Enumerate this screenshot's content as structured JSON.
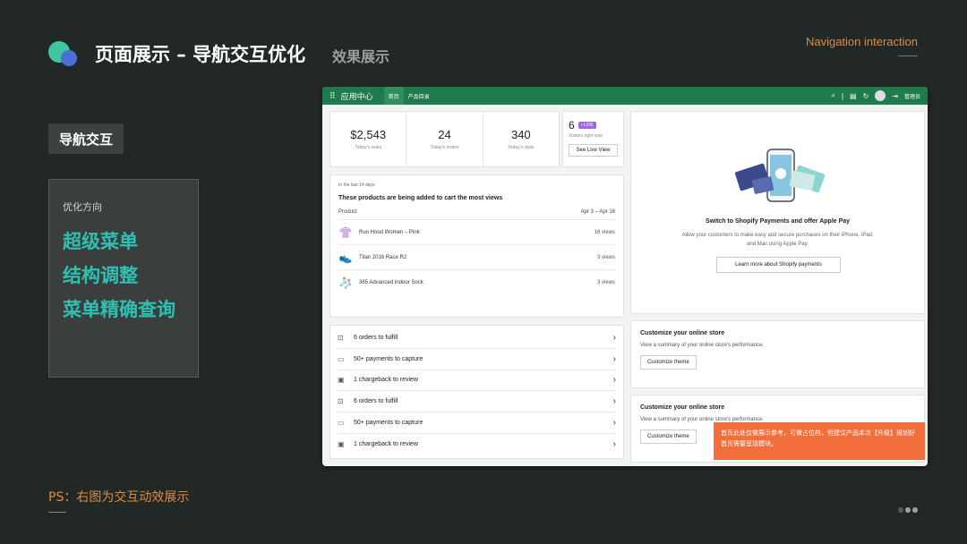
{
  "header": {
    "title": "页面展示 – 导航交互优化",
    "subtitle": "效果展示",
    "corner_label": "Navigation interaction"
  },
  "left": {
    "tag": "导航交互",
    "box_title": "优化方向",
    "items": [
      "超级菜单",
      "结构调整",
      "菜单精确查询"
    ]
  },
  "footer": {
    "ps": "PS：右图为交互动效展示"
  },
  "shot": {
    "app_name": "应用中心",
    "tabs": [
      "首页",
      "产品目录"
    ],
    "admin_label": "管理员",
    "stats": [
      {
        "value": "$2,543",
        "label": "Today's sales"
      },
      {
        "value": "24",
        "label": "Today's orders"
      },
      {
        "value": "340",
        "label": "Today's visits"
      }
    ],
    "live": {
      "value": "6",
      "badge": "• LIVE",
      "label": "Visitors right now",
      "button": "See Live View"
    },
    "products": {
      "range_label": "In the last 14 days",
      "heading": "These products are being added to cart the most views",
      "col_product": "Product",
      "col_date": "Apr 3 – Apr 16",
      "rows": [
        {
          "name": "Run Hood Women – Pink",
          "views": "16 views"
        },
        {
          "name": "Titan 2016 Race R2",
          "views": "3 views"
        },
        {
          "name": "365 Advanced Indoor Sock",
          "views": "3 views"
        }
      ]
    },
    "tasks": [
      "6 orders to fulfill",
      "50+ payments to capture",
      "1 chargeback to review",
      "6 orders to fulfill",
      "50+ payments to capture",
      "1 chargeback to review"
    ],
    "pay": {
      "heading": "Switch to Shopify Payments and offer Apple Pay",
      "desc": "Allow your customers to make easy and secure purchases on their iPhone, iPad, and Mac using Apple Pay.",
      "button": "Learn more about Shopify payments"
    },
    "customize": [
      {
        "heading": "Customize your online store",
        "desc": "View a summary of your online store's performance.",
        "button": "Customize theme"
      },
      {
        "heading": "Customize your online store",
        "desc": "View a summary of your online store's performance.",
        "button": "Customize theme"
      }
    ],
    "note": "首页此处仅做展示参考，可做占位符，但建议产品本次【升级】规划好首页需要呈现模块。"
  }
}
